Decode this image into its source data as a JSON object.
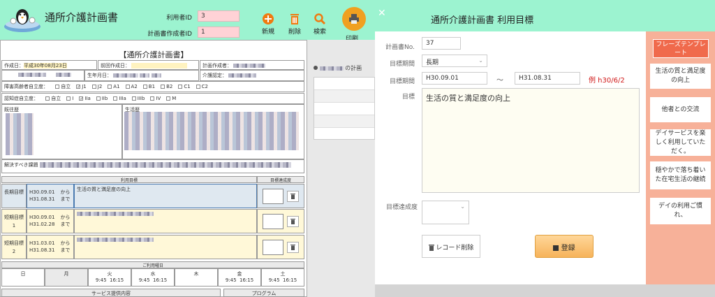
{
  "app": {
    "title": "通所介護計画書"
  },
  "header": {
    "user_id_label": "利用者ID",
    "user_id_value": "3",
    "plan_author_id_label": "計画書作成者ID",
    "plan_author_id_value": "1",
    "new_label": "新規",
    "delete_label": "削除",
    "search_label": "検索",
    "print_label": "印刷"
  },
  "doc": {
    "title": "【通所介護計画書】",
    "created_label": "作成日：",
    "created_value": "平成30年08月23日",
    "prev_created_label": "前回作成日：",
    "plan_creator_label": "計画作成者：",
    "birth_label": "生年月日：",
    "care_cert_label": "介護認定：",
    "disability_label": "障害高齢者自立度：",
    "disability_options": [
      "自立",
      "J1",
      "J2",
      "A1",
      "A2",
      "B1",
      "B2",
      "C1",
      "C2"
    ],
    "dementia_label": "認知症自立度：",
    "dementia_options": [
      "自立",
      "I",
      "IIa",
      "IIb",
      "IIIa",
      "IIIb",
      "IV",
      "M"
    ],
    "medical_history_label": "既往歴",
    "life_history_label": "生活歴",
    "issues_label": "解決すべき課題",
    "goal_header": "利用目標",
    "achievement_header": "目標達成度",
    "goals": [
      {
        "type": "長期目標",
        "num": "",
        "from": "H30.09.01",
        "to": "H31.08.31",
        "from_suffix": "から",
        "to_suffix": "まで",
        "text": "生活の質と満足度の向上"
      },
      {
        "type": "短期目標",
        "num": "1",
        "from": "H30.09.01",
        "to": "H31.02.28",
        "from_suffix": "から",
        "to_suffix": "まで",
        "text": ""
      },
      {
        "type": "短期目標",
        "num": "2",
        "from": "H31.03.01",
        "to": "H31.08.31",
        "from_suffix": "から",
        "to_suffix": "まで",
        "text": ""
      }
    ],
    "days_header": "ご利用曜日",
    "days": [
      {
        "day": "日",
        "start": "",
        "end": ""
      },
      {
        "day": "月",
        "start": "",
        "end": ""
      },
      {
        "day": "火",
        "start": "9:45",
        "end": "16:15"
      },
      {
        "day": "水",
        "start": "9:45",
        "end": "16:15"
      },
      {
        "day": "木",
        "start": "",
        "end": ""
      },
      {
        "day": "金",
        "start": "9:45",
        "end": "16:15"
      },
      {
        "day": "土",
        "start": "9:45",
        "end": "16:15"
      }
    ],
    "service_header": "サービス提供内容",
    "program_header": "プログラム"
  },
  "middle": {
    "list_title_suffix": "の計画"
  },
  "modal": {
    "title": "通所介護計画書 利用目標",
    "plan_no_label": "計画書No.",
    "plan_no_value": "37",
    "period_type_label": "目標期間",
    "period_type_value": "長期",
    "period_label": "目標期間",
    "period_from": "H30.09.01",
    "tilde": "〜",
    "period_to": "H31.08.31",
    "period_example": "例 h30/6/2",
    "goal_label": "目標",
    "goal_value": "生活の質と満足度の向上",
    "achievement_label": "目標達成度",
    "achievement_value": "",
    "delete_record_label": "レコード削除",
    "register_label": "登録"
  },
  "phrases": {
    "title": "フレーズテンプレート",
    "items": [
      "生活の質と満足度の向上",
      "他者との交流",
      "デイサービスを楽しく利用していただく。",
      "穏やかで落ち着いた在宅生活の継続",
      "デイの利用ご慣れ、"
    ]
  },
  "colors": {
    "header_bg": "#9cf3d0",
    "accent_orange": "#f0a020",
    "phrase_bg": "#f7b199"
  }
}
